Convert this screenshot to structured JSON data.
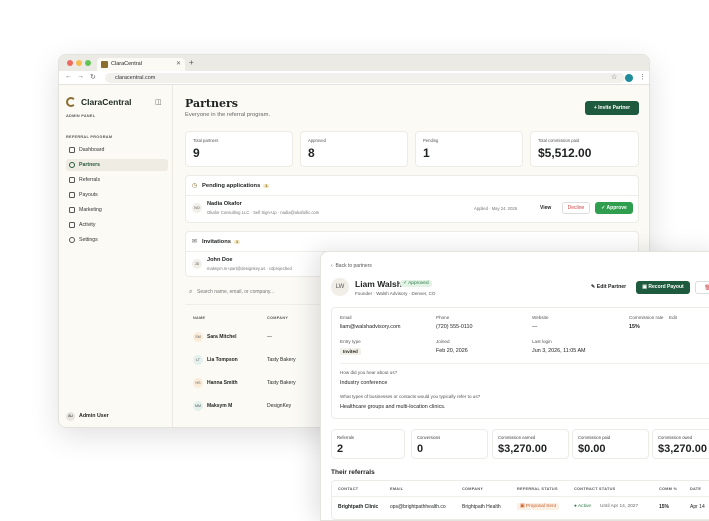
{
  "browser": {
    "tab_title": "ClaraCentral",
    "url": "claracentral.com"
  },
  "sidebar": {
    "brand": "ClaraCentral",
    "admin_label": "ADMIN PANEL",
    "section_label": "REFERRAL PROGRAM",
    "items": [
      {
        "label": "Dashboard"
      },
      {
        "label": "Partners"
      },
      {
        "label": "Referrals"
      },
      {
        "label": "Payouts"
      },
      {
        "label": "Marketing"
      },
      {
        "label": "Activity"
      },
      {
        "label": "Settings"
      }
    ],
    "user": {
      "initials": "AU",
      "name": "Admin User"
    }
  },
  "main": {
    "title": "Partners",
    "subtitle": "Everyone in the referral program.",
    "invite_button": "+ Invite Partner",
    "stats": [
      {
        "label": "Total partners",
        "value": "9"
      },
      {
        "label": "Approved",
        "value": "8"
      },
      {
        "label": "Pending",
        "value": "1"
      },
      {
        "label": "Total commission paid",
        "value": "$5,512.00"
      }
    ],
    "pending": {
      "title": "Pending applications",
      "count": "1",
      "row": {
        "initials": "NO",
        "name": "Nadia Okafor",
        "meta": "Okafor Consulting LLC · Self Sign-Up · nadia@okafoific.com",
        "applied": "Applied · May 24, 2026",
        "view": "View",
        "decline": "Decline",
        "approve": "✓ Approve"
      }
    },
    "invitations": {
      "title": "Invitations",
      "count": "1",
      "row": {
        "initials": "JD",
        "name": "John Doe",
        "meta": "maksym.m+part@designkey.us · cdprojecbed"
      }
    },
    "search_placeholder": "Search name, email, or company...",
    "table": {
      "headers": [
        "NAME",
        "COMPANY"
      ],
      "rows": [
        {
          "initials": "SM",
          "name": "Sara Mitchel",
          "company": "—"
        },
        {
          "initials": "LT",
          "name": "Lia Tompson",
          "company": "Tasty Bakery"
        },
        {
          "initials": "HS",
          "name": "Hanna Smith",
          "company": "Tasty Bakery"
        },
        {
          "initials": "MM",
          "name": "Maksym M",
          "company": "DesignKey"
        }
      ]
    }
  },
  "detail": {
    "back": "Back to partners",
    "initials": "LW",
    "name": "Liam Walsh",
    "status": "✓ Approved",
    "subtitle": "Founder · Walsh Advisory · Denver, CO",
    "edit_button": "Edit Partner",
    "payout_button": "Record Payout",
    "delete_button": "D",
    "fields": {
      "email_label": "Email",
      "email": "liam@walshadvisory.com",
      "phone_label": "Phone",
      "phone": "(720) 555-0110",
      "website_label": "Website",
      "website": "—",
      "rate_label": "Commission rate",
      "rate_edit": "Edit",
      "rate": "15%",
      "entry_label": "Entry type",
      "entry": "Invited",
      "joined_label": "Joined",
      "joined": "Feb 20, 2026",
      "login_label": "Last login",
      "login": "Jun 3, 2026, 11:05 AM",
      "q1": "How did you hear about us?",
      "a1": "Industry conference",
      "q2": "What types of businesses or contacts would you typically refer to us?",
      "a2": "Healthcare groups and multi-location clinics."
    },
    "stats": [
      {
        "label": "Referrals",
        "value": "2"
      },
      {
        "label": "Conversions",
        "value": "0"
      },
      {
        "label": "Commission earned",
        "value": "$3,270.00"
      },
      {
        "label": "Commission paid",
        "value": "$0.00"
      },
      {
        "label": "Commission owed",
        "value": "$3,270.00"
      }
    ],
    "referrals_title": "Their referrals",
    "ref_headers": [
      "CONTACT",
      "EMAIL",
      "COMPANY",
      "REFERRAL STATUS",
      "CONTRACT STATUS",
      "COMM %",
      "DATE"
    ],
    "ref_row": {
      "contact": "Brightpath Clinic",
      "email": "ops@brightpathhealth.co",
      "company": "Brightpath Health",
      "status": "Proposal Sent",
      "contract": "● Active",
      "until": "Until Apr 14, 2027",
      "comm": "15%",
      "date": "Apr 14"
    }
  },
  "colors": {
    "accent": "#1e5a3d",
    "brand": "#8b6d2f",
    "warning": "#c7612a"
  }
}
